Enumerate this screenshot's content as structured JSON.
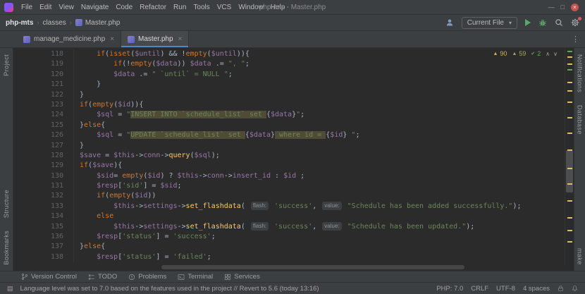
{
  "icons": {
    "minimize": "—",
    "maximize": "□",
    "close": "×",
    "chevron": "›",
    "tab_close": "×",
    "dropdown_caret": "▾",
    "more_vertical": "⋮",
    "warning_triangle": "▲",
    "check": "✔",
    "chevron_up": "∧",
    "chevron_down": "∨",
    "menu_burger": "▤"
  },
  "window": {
    "title": "php-mts - Master.php",
    "menu": [
      "File",
      "Edit",
      "View",
      "Navigate",
      "Code",
      "Refactor",
      "Run",
      "Tools",
      "VCS",
      "Window",
      "Help"
    ]
  },
  "navbar": {
    "breadcrumbs": [
      {
        "label": "php-mts",
        "root": true
      },
      {
        "label": "classes"
      },
      {
        "label": "Master.php",
        "icon": "php-file"
      }
    ],
    "run_config": "Current File"
  },
  "tabs": [
    {
      "label": "manage_medicine.php",
      "active": false
    },
    {
      "label": "Master.php",
      "active": true
    }
  ],
  "tool_stripes": {
    "left": [
      "Project",
      "Structure",
      "Bookmarks"
    ],
    "right_top": [
      "Notifications",
      "Database"
    ],
    "right_bottom": [
      "make"
    ]
  },
  "inspections": {
    "warnings": "90",
    "weak_warnings": "59",
    "passed": "2"
  },
  "editor": {
    "lines": [
      {
        "n": 118,
        "t": [
          [
            "p",
            "    "
          ],
          [
            "k",
            "if"
          ],
          [
            "p",
            "("
          ],
          [
            "k",
            "isset"
          ],
          [
            "p",
            "("
          ],
          [
            "v",
            "$until"
          ],
          [
            "p",
            ") && !"
          ],
          [
            "k",
            "empty"
          ],
          [
            "p",
            "("
          ],
          [
            "v",
            "$until"
          ],
          [
            "p",
            ")){"
          ]
        ]
      },
      {
        "n": 119,
        "t": [
          [
            "p",
            "        "
          ],
          [
            "k",
            "if"
          ],
          [
            "p",
            "(!"
          ],
          [
            "k",
            "empty"
          ],
          [
            "p",
            "("
          ],
          [
            "v",
            "$data"
          ],
          [
            "p",
            ")) "
          ],
          [
            "v",
            "$data"
          ],
          [
            "p",
            " .= "
          ],
          [
            "s",
            "\", \""
          ],
          [
            "p",
            ";"
          ]
        ]
      },
      {
        "n": 120,
        "t": [
          [
            "p",
            "        "
          ],
          [
            "v",
            "$data"
          ],
          [
            "p",
            " .= "
          ],
          [
            "s",
            "\" `until` = NULL \""
          ],
          [
            "p",
            ";"
          ]
        ]
      },
      {
        "n": 121,
        "t": [
          [
            "p",
            "    }"
          ]
        ]
      },
      {
        "n": 122,
        "t": [
          [
            "p",
            "}"
          ]
        ]
      },
      {
        "n": 123,
        "t": [
          [
            "k",
            "if"
          ],
          [
            "p",
            "("
          ],
          [
            "k",
            "empty"
          ],
          [
            "p",
            "("
          ],
          [
            "v",
            "$id"
          ],
          [
            "p",
            ")){"
          ]
        ]
      },
      {
        "n": 124,
        "t": [
          [
            "p",
            "    "
          ],
          [
            "v",
            "$sql"
          ],
          [
            "p",
            " = "
          ],
          [
            "s",
            "\""
          ],
          [
            "s hl",
            "INSERT INTO `schedule_list` set "
          ],
          [
            "p",
            "{"
          ],
          [
            "v",
            "$data"
          ],
          [
            "p",
            "}"
          ],
          [
            "s",
            "\""
          ],
          [
            "p",
            ";"
          ]
        ]
      },
      {
        "n": 125,
        "t": [
          [
            "p",
            "}"
          ],
          [
            "k",
            "else"
          ],
          [
            "p",
            "{"
          ]
        ]
      },
      {
        "n": 126,
        "t": [
          [
            "p",
            "    "
          ],
          [
            "v",
            "$sql"
          ],
          [
            "p",
            " = "
          ],
          [
            "s",
            "\""
          ],
          [
            "s hl",
            "UPDATE `schedule_list` set "
          ],
          [
            "p",
            "{"
          ],
          [
            "v",
            "$data"
          ],
          [
            "p",
            "}"
          ],
          [
            "s hl",
            " where id = "
          ],
          [
            "p",
            "{"
          ],
          [
            "v",
            "$id"
          ],
          [
            "p",
            "}"
          ],
          [
            "s",
            " \""
          ],
          [
            "p",
            ";"
          ]
        ]
      },
      {
        "n": 127,
        "t": [
          [
            "p",
            "}"
          ]
        ]
      },
      {
        "n": 128,
        "t": [
          [
            "v",
            "$save"
          ],
          [
            "p",
            " = "
          ],
          [
            "v",
            "$this"
          ],
          [
            "p",
            "->"
          ],
          [
            "v",
            "conn"
          ],
          [
            "p",
            "->"
          ],
          [
            "f",
            "query"
          ],
          [
            "p",
            "("
          ],
          [
            "v",
            "$sql"
          ],
          [
            "p",
            ");"
          ]
        ]
      },
      {
        "n": 129,
        "t": [
          [
            "k",
            "if"
          ],
          [
            "p",
            "("
          ],
          [
            "v",
            "$save"
          ],
          [
            "p",
            "){"
          ]
        ]
      },
      {
        "n": 130,
        "t": [
          [
            "p",
            "    "
          ],
          [
            "v",
            "$sid"
          ],
          [
            "p",
            "= "
          ],
          [
            "k",
            "empty"
          ],
          [
            "p",
            "("
          ],
          [
            "v",
            "$id"
          ],
          [
            "p",
            ") ? "
          ],
          [
            "v",
            "$this"
          ],
          [
            "p",
            "->"
          ],
          [
            "v",
            "conn"
          ],
          [
            "p",
            "->"
          ],
          [
            "v",
            "insert_id"
          ],
          [
            "p",
            " : "
          ],
          [
            "v",
            "$id"
          ],
          [
            "p",
            " ;"
          ]
        ]
      },
      {
        "n": 131,
        "t": [
          [
            "p",
            "    "
          ],
          [
            "v",
            "$resp"
          ],
          [
            "p",
            "["
          ],
          [
            "s",
            "'sid'"
          ],
          [
            "p",
            "] = "
          ],
          [
            "v",
            "$sid"
          ],
          [
            "p",
            ";"
          ]
        ]
      },
      {
        "n": 132,
        "t": [
          [
            "p",
            "    "
          ],
          [
            "k",
            "if"
          ],
          [
            "p",
            "("
          ],
          [
            "k",
            "empty"
          ],
          [
            "p",
            "("
          ],
          [
            "v",
            "$id"
          ],
          [
            "p",
            "))"
          ]
        ]
      },
      {
        "n": 133,
        "t": [
          [
            "p",
            "        "
          ],
          [
            "v",
            "$this"
          ],
          [
            "p",
            "->"
          ],
          [
            "v",
            "settings"
          ],
          [
            "p",
            "->"
          ],
          [
            "f",
            "set_flashdata"
          ],
          [
            "p",
            "( "
          ],
          [
            "hint",
            "flash:"
          ],
          [
            "p",
            " "
          ],
          [
            "s",
            "'success'"
          ],
          [
            "p",
            ", "
          ],
          [
            "hint",
            "value:"
          ],
          [
            "p",
            " "
          ],
          [
            "s",
            "\"Schedule has been added successfully.\""
          ],
          [
            "p",
            ");"
          ]
        ]
      },
      {
        "n": 134,
        "t": [
          [
            "p",
            "    "
          ],
          [
            "k",
            "else"
          ]
        ]
      },
      {
        "n": 135,
        "t": [
          [
            "p",
            "        "
          ],
          [
            "v",
            "$this"
          ],
          [
            "p",
            "->"
          ],
          [
            "v",
            "settings"
          ],
          [
            "p",
            "->"
          ],
          [
            "f",
            "set_flashdata"
          ],
          [
            "p",
            "( "
          ],
          [
            "hint",
            "flash:"
          ],
          [
            "p",
            " "
          ],
          [
            "s",
            "'success'"
          ],
          [
            "p",
            ", "
          ],
          [
            "hint",
            "value:"
          ],
          [
            "p",
            " "
          ],
          [
            "s",
            "\"Schedule has been updated.\""
          ],
          [
            "p",
            ");"
          ]
        ]
      },
      {
        "n": 136,
        "t": [
          [
            "p",
            "    "
          ],
          [
            "v",
            "$resp"
          ],
          [
            "p",
            "["
          ],
          [
            "s",
            "'status'"
          ],
          [
            "p",
            "] = "
          ],
          [
            "s",
            "'success'"
          ],
          [
            "p",
            ";"
          ]
        ]
      },
      {
        "n": 137,
        "t": [
          [
            "p",
            "}"
          ],
          [
            "k",
            "else"
          ],
          [
            "p",
            "{"
          ]
        ]
      },
      {
        "n": 138,
        "t": [
          [
            "p",
            "    "
          ],
          [
            "v",
            "$resp"
          ],
          [
            "p",
            "["
          ],
          [
            "s",
            "'status'"
          ],
          [
            "p",
            "] = "
          ],
          [
            "s",
            "'failed'"
          ],
          [
            "p",
            ";"
          ]
        ]
      }
    ]
  },
  "bottom_tools": [
    {
      "id": "version-control",
      "label": "Version Control"
    },
    {
      "id": "todo",
      "label": "TODO"
    },
    {
      "id": "problems",
      "label": "Problems"
    },
    {
      "id": "terminal",
      "label": "Terminal"
    },
    {
      "id": "services",
      "label": "Services"
    }
  ],
  "statusbar": {
    "message": "Language level was set to 7.0 based on the features used in the project // Revert to 5.6 (today 13:16)",
    "php_version": "PHP: 7.0",
    "line_separator": "CRLF",
    "encoding": "UTF-8",
    "indent": "4 spaces"
  },
  "colors": {
    "accent_blue": "#4A88C7",
    "keyword": "#cc7832",
    "string": "#6a8759",
    "variable": "#9876aa",
    "function": "#ffc66d",
    "warning": "#d9bf68",
    "ok_green": "#62a757"
  }
}
